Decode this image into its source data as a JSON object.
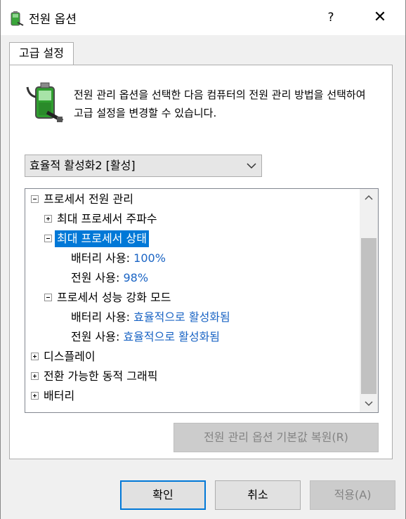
{
  "window": {
    "title": "전원 옵션",
    "help_glyph": "?",
    "close_glyph": "✕",
    "icon": "battery-plug-icon"
  },
  "tab": {
    "label": "고급 설정"
  },
  "description": "전원 관리 옵션을 선택한 다음 컴퓨터의 전원 관리 방법을 선택하여 고급 설정을 변경할 수 있습니다.",
  "plan_select": {
    "value": "효율적 활성화2 [활성]"
  },
  "tree": {
    "items": [
      {
        "label": "프로세서 전원 관리"
      },
      {
        "label": "최대 프로세서 주파수"
      },
      {
        "label": "최대 프로세서 상태"
      },
      {
        "label": "배터리 사용:",
        "value": "100%"
      },
      {
        "label": "전원 사용:",
        "value": "98%"
      },
      {
        "label": "프로세서 성능 강화 모드"
      },
      {
        "label": "배터리 사용:",
        "value": "효율적으로 활성화됨"
      },
      {
        "label": "전원 사용:",
        "value": "효율적으로 활성화됨"
      },
      {
        "label": "디스플레이"
      },
      {
        "label": "전환 가능한 동적 그래픽"
      },
      {
        "label": "배터리"
      }
    ]
  },
  "buttons": {
    "restore": "전원 관리 옵션 기본값 복원(R)",
    "ok": "확인",
    "cancel": "취소",
    "apply": "적용(A)"
  },
  "colors": {
    "selection": "#0078d7",
    "value_text": "#1a64c4",
    "disabled_text": "#838383"
  }
}
